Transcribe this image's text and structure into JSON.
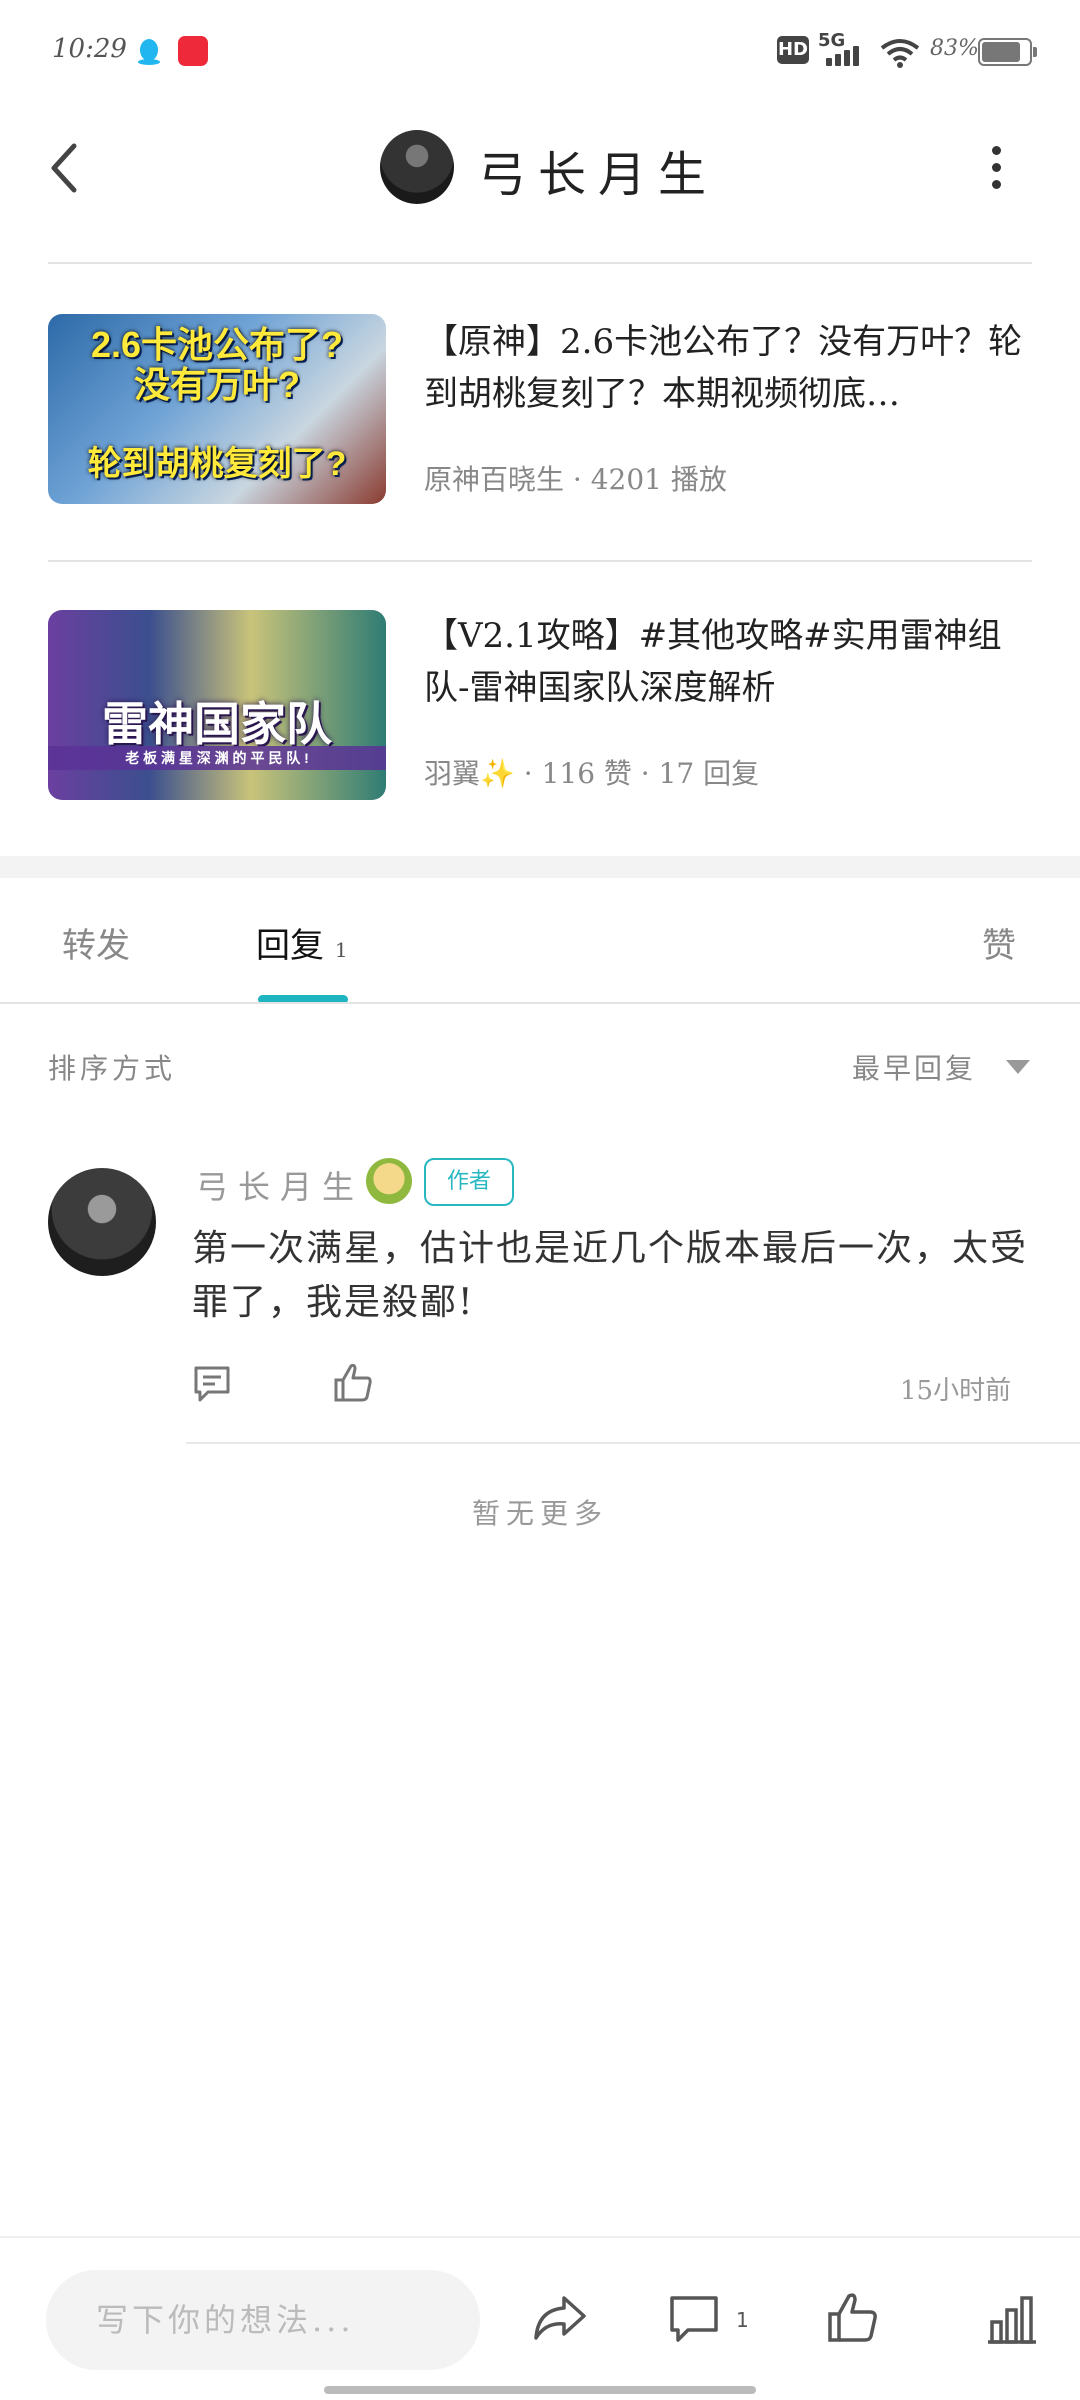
{
  "status_bar": {
    "time": "10:29",
    "network": "5G",
    "hd": "HD",
    "battery_text": "83%",
    "battery_level": 0.83
  },
  "header": {
    "title": "弓长月生"
  },
  "videos": [
    {
      "title": "【原神】2.6卡池公布了？没有万叶？轮到胡桃复刻了？本期视频彻底…",
      "meta": "原神百晓生 · 4201 播放",
      "thumb_text_1": "2.6卡池公布了?",
      "thumb_text_2": "没有万叶?",
      "thumb_text_3": "轮到胡桃复刻了?"
    },
    {
      "title": "【V2.1攻略】#其他攻略#实用雷神组队-雷神国家队深度解析",
      "meta": "羽翼✨ · 116 赞 · 17 回复",
      "thumb_text_1": "雷神国家队",
      "thumb_text_2": "老 板 满 星 深 渊 的 平 民 队 !"
    }
  ],
  "tabs": {
    "forward": "转发",
    "reply": "回复",
    "reply_count": "1",
    "like": "赞"
  },
  "sort": {
    "label": "排序方式",
    "value": "最早回复"
  },
  "comment": {
    "author": "弓长月生",
    "badge": "作者",
    "text": "第一次满星，估计也是近几个版本最后一次，太受罪了，我是殺鄙!",
    "time": "15小时前"
  },
  "no_more": "暂无更多",
  "bottom_bar": {
    "placeholder": "写下你的想法...",
    "comment_count": "1"
  },
  "colors": {
    "accent": "#1fb5c0"
  }
}
